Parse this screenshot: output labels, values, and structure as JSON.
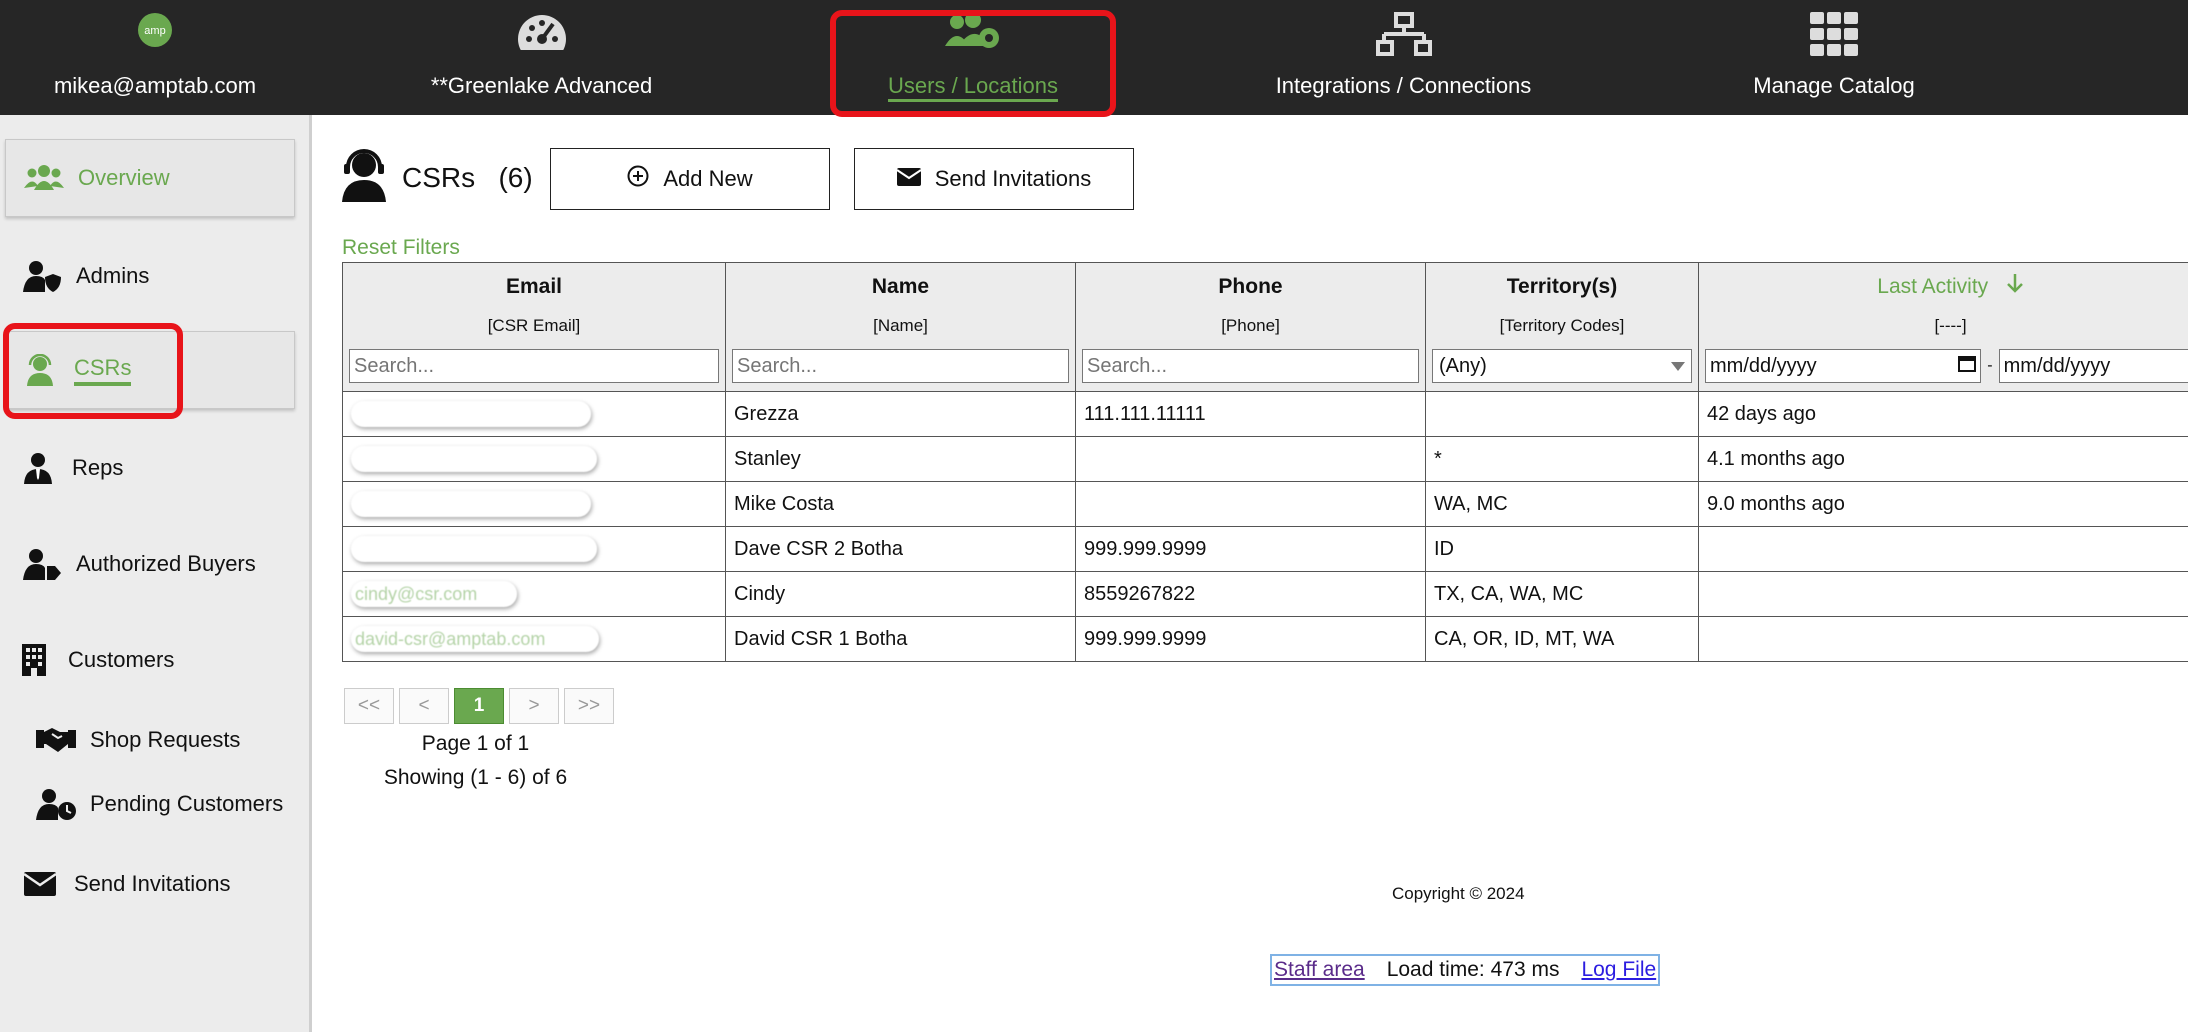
{
  "nav": {
    "user_email": "mikea@amptab.com",
    "logo_text": "amp",
    "greenlake": "**Greenlake Advanced",
    "users_locations": "Users / Locations",
    "integrations": "Integrations / Connections",
    "catalog": "Manage Catalog"
  },
  "sidebar": {
    "items": [
      {
        "label": "Overview"
      },
      {
        "label": "Admins"
      },
      {
        "label": "CSRs"
      },
      {
        "label": "Reps"
      },
      {
        "label": "Authorized Buyers"
      },
      {
        "label": "Customers"
      },
      {
        "label": "Shop Requests"
      },
      {
        "label": "Pending Customers"
      },
      {
        "label": "Send Invitations"
      }
    ]
  },
  "main": {
    "title": "CSRs",
    "count": "(6)",
    "add_new": "Add New",
    "send_invitations": "Send Invitations",
    "reset_filters": "Reset Filters"
  },
  "table": {
    "columns": [
      {
        "title": "Email",
        "sub": "[CSR Email]",
        "placeholder": "Search..."
      },
      {
        "title": "Name",
        "sub": "[Name]",
        "placeholder": "Search..."
      },
      {
        "title": "Phone",
        "sub": "[Phone]",
        "placeholder": "Search..."
      },
      {
        "title": "Territory(s)",
        "sub": "[Territory Codes]",
        "select": "(Any)"
      },
      {
        "title": "Last Activity",
        "sub": "[----]",
        "date_from": "mm/dd/yyyy",
        "date_sep": "-",
        "date_to": "mm/dd/yyyy"
      }
    ],
    "rows": [
      {
        "email": "",
        "name": "Grezza",
        "phone": "111.111.11111",
        "territory": "",
        "last": "42 days ago"
      },
      {
        "email": "",
        "name": "Stanley",
        "phone": "",
        "territory": "*",
        "last": "4.1 months ago"
      },
      {
        "email": "",
        "name": "Mike Costa",
        "phone": "",
        "territory": "WA, MC",
        "last": "9.0 months ago"
      },
      {
        "email": "",
        "name": "Dave CSR 2 Botha",
        "phone": "999.999.9999",
        "territory": "ID",
        "last": ""
      },
      {
        "email": "cindy@csr.com",
        "name": "Cindy",
        "phone": "8559267822",
        "territory": "TX, CA, WA, MC",
        "last": ""
      },
      {
        "email": "david-csr@amptab.com",
        "name": "David CSR 1 Botha",
        "phone": "999.999.9999",
        "territory": "CA, OR, ID, MT, WA",
        "last": ""
      }
    ]
  },
  "pager": {
    "first": "<<",
    "prev": "<",
    "current": "1",
    "next": ">",
    "last": ">>",
    "page_info": "Page 1 of 1",
    "showing": "Showing (1 - 6) of 6"
  },
  "footer": {
    "copyright": "Copyright © 2024",
    "staff_area": "Staff area",
    "load_time": "Load time: 473 ms",
    "log_file": "Log File"
  },
  "colors": {
    "accent": "#6aa84f",
    "nav_bg": "#262626",
    "highlight": "#e8141a"
  }
}
